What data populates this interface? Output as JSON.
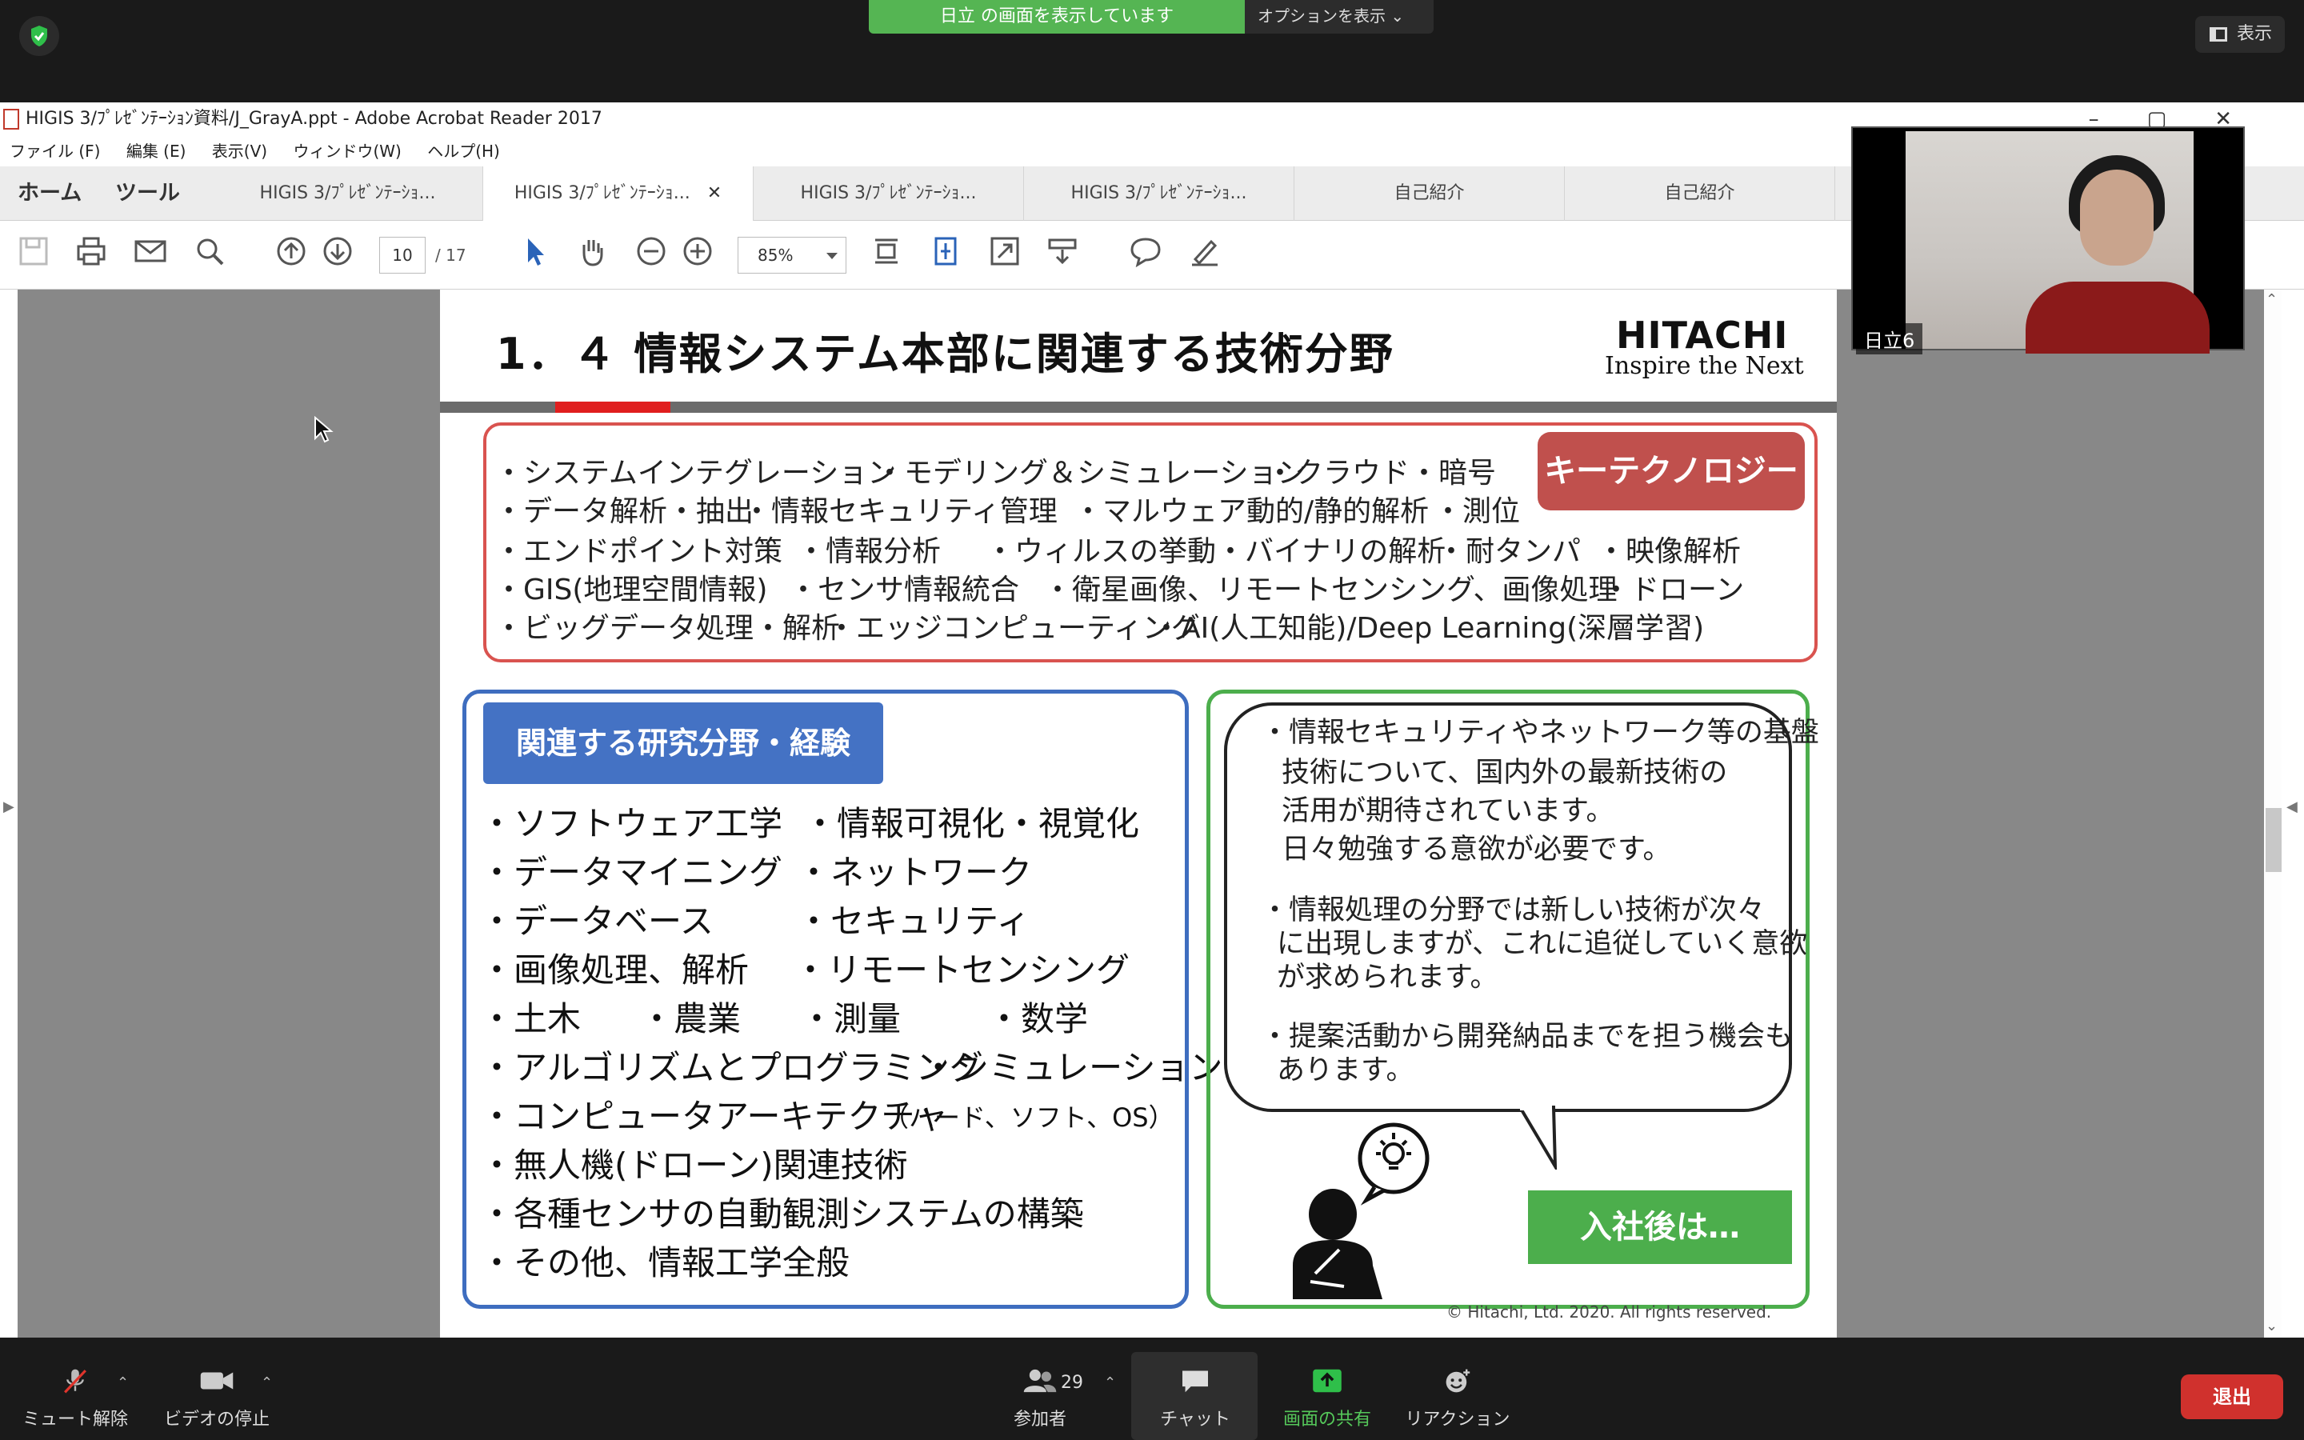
{
  "zoom_meeting": {
    "share_banner": "日立 の画面を表示しています",
    "options_label": "オプションを表示",
    "view_label": "表示",
    "video_name": "日立6",
    "participant_count": "29",
    "controls": {
      "mute": "ミュート解除",
      "video": "ビデオの停止",
      "participants": "参加者",
      "chat": "チャット",
      "share": "画面の共有",
      "reaction": "リアクション",
      "exit": "退出"
    }
  },
  "acrobat": {
    "window_title": "HIGIS 3/ﾌﾟﾚｾﾞﾝﾃｰｼｮﾝ資料/J_GrayA.ppt - Adobe Acrobat Reader 2017",
    "menu": [
      "ファイル (F)",
      "編集 (E)",
      "表示(V)",
      "ウィンドウ(W)",
      "ヘルプ(H)"
    ],
    "home_label": "ホーム",
    "tools_label": "ツール",
    "tabs": [
      "HIGIS 3/ﾌﾟﾚｾﾞﾝﾃｰｼｮ...",
      "HIGIS 3/ﾌﾟﾚｾﾞﾝﾃｰｼｮ...",
      "HIGIS 3/ﾌﾟﾚｾﾞﾝﾃｰｼｮ...",
      "HIGIS 3/ﾌﾟﾚｾﾞﾝﾃｰｼｮ...",
      "自己紹介",
      "自己紹介"
    ],
    "current_page": "10",
    "total_pages": "/ 17",
    "zoom": "85%"
  },
  "slide": {
    "title": "1．４ 情報システム本部に関連する技術分野",
    "logo_main": "HITACHI",
    "logo_tagline": "Inspire the Next",
    "key_label": "キーテクノロジー",
    "key_lines": [
      [
        "・システムインテグレーション",
        "・モデリング＆シミュレーション",
        "・クラウド",
        "・暗号"
      ],
      [
        "・データ解析・抽出",
        "・情報セキュリティ管理",
        "・マルウェア動的/静的解析",
        "・測位"
      ],
      [
        "・エンドポイント対策",
        "・情報分析",
        "・ウィルスの挙動・バイナリの解析",
        "・耐タンパ",
        "・映像解析"
      ],
      [
        "・GIS(地理空間情報)",
        "・センサ情報統合",
        "・衛星画像、リモートセンシング、画像処理",
        "・ドローン"
      ],
      [
        "・ビッグデータ処理・解析",
        "・エッジコンピューティング",
        "・AI(人工知能)/Deep Learning(深層学習)"
      ]
    ],
    "research_label": "関連する研究分野・経験",
    "research_lines": [
      [
        "・ソフトウェア工学",
        "・情報可視化・視覚化"
      ],
      [
        "・データマイニング",
        "・ネットワーク"
      ],
      [
        "・データベース",
        "・セキュリティ"
      ],
      [
        "・画像処理、解析",
        "・リモートセンシング"
      ],
      [
        "・土木",
        "・農業",
        "・測量",
        "・数学"
      ],
      [
        "・アルゴリズムとプログラミング",
        "・シミュレーション"
      ],
      [
        "・コンピュータアーキテクチャ",
        "（ハード、ソフト、OS）"
      ],
      [
        "・無人機(ドローン)関連技術"
      ],
      [
        "・各種センサの自動観測システムの構築"
      ],
      [
        "・その他、情報工学全般"
      ]
    ],
    "future_lines": [
      "・情報セキュリティやネットワーク等の基盤",
      "技術について、国内外の最新技術の",
      "活用が期待されています。",
      "日々勉強する意欲が必要です。",
      "・情報処理の分野では新しい技術が次々",
      "に出現しますが、これに追従していく意欲",
      "が求められます。",
      "・提案活動から開発納品までを担う機会も",
      "あります。"
    ],
    "join_label": "入社後は…",
    "copyright": "© Hitachi, Ltd. 2020. All rights reserved."
  }
}
